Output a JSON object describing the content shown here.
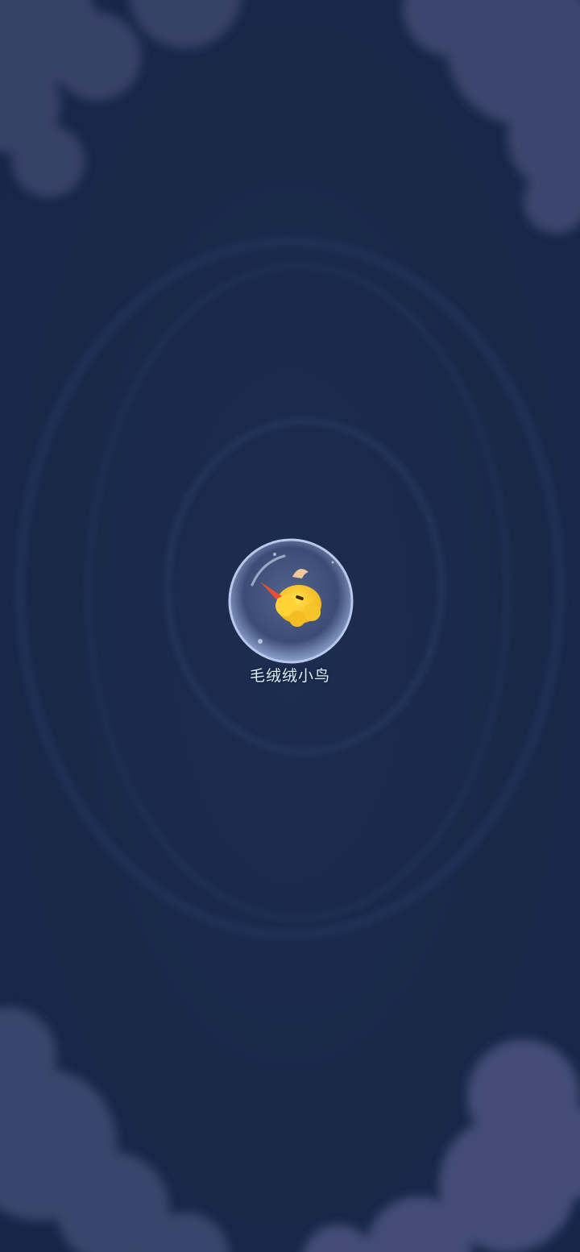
{
  "scene": {
    "background_color": "#1b2a4c",
    "cloud_color": "#3f4a72"
  },
  "item": {
    "label": "毛绒绒小鸟",
    "icon": "fluffy-bird-icon",
    "label_color": "#d7f2f4"
  }
}
